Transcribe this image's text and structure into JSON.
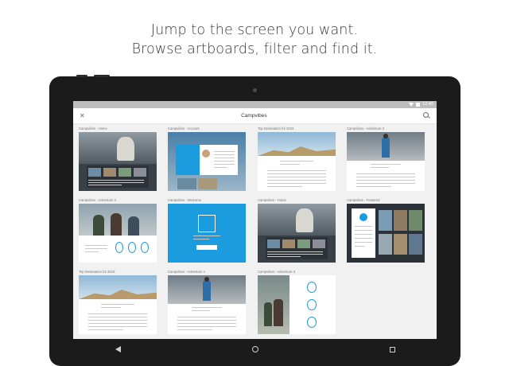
{
  "headline": {
    "line1": "Jump to the screen you want.",
    "line2": "Browse artboards, filter and find it."
  },
  "status": {
    "time": "12:45"
  },
  "app": {
    "title": "Campvibes"
  },
  "artboards": [
    {
      "label": "Campvibes - Home",
      "variant": "home"
    },
    {
      "label": "Campvibes - Account",
      "variant": "account"
    },
    {
      "label": "Top Destination for 2016",
      "variant": "mountain"
    },
    {
      "label": "Campvibes - Adventure 2",
      "variant": "hiker"
    },
    {
      "label": "Campvibes - Adventure 3",
      "variant": "group"
    },
    {
      "label": "Campvibes - Welcome",
      "variant": "welcome"
    },
    {
      "label": "Campvibes - Home",
      "variant": "home"
    },
    {
      "label": "Campvibes - Featured",
      "variant": "featured"
    },
    {
      "label": "Top Destination for 2016",
      "variant": "mountain"
    },
    {
      "label": "Campvibes - Adventure 1",
      "variant": "hiker"
    },
    {
      "label": "Campvibes - Adventure 3",
      "variant": "group-portrait"
    }
  ],
  "colors": {
    "accent_blue": "#1a9cde",
    "dark_panel": "#2c3238",
    "tablet_body": "#1b1b1b"
  }
}
